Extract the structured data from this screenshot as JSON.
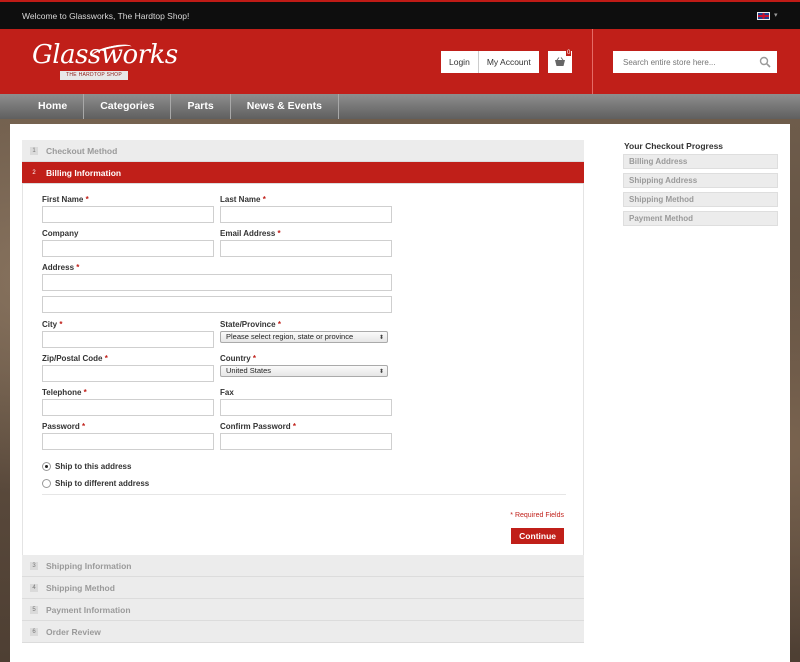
{
  "topbar": {
    "welcome": "Welcome to Glassworks, The Hardtop Shop!"
  },
  "header": {
    "logo_text": "Glassworks",
    "logo_sub": "THE HARDTOP SHOP",
    "login": "Login",
    "my_account": "My Account",
    "cart_count": "0",
    "search_placeholder": "Search entire store here..."
  },
  "nav": [
    "Home",
    "Categories",
    "Parts",
    "News & Events"
  ],
  "steps": {
    "s1": {
      "num": "1",
      "label": "Checkout Method"
    },
    "s2": {
      "num": "2",
      "label": "Billing Information"
    },
    "s3": {
      "num": "3",
      "label": "Shipping Information"
    },
    "s4": {
      "num": "4",
      "label": "Shipping Method"
    },
    "s5": {
      "num": "5",
      "label": "Payment Information"
    },
    "s6": {
      "num": "6",
      "label": "Order Review"
    }
  },
  "billing": {
    "first_name": "First Name",
    "last_name": "Last Name",
    "company": "Company",
    "email": "Email Address",
    "address": "Address",
    "city": "City",
    "state": "State/Province",
    "state_value": "Please select region, state or province",
    "zip": "Zip/Postal Code",
    "country": "Country",
    "country_value": "United States",
    "telephone": "Telephone",
    "fax": "Fax",
    "password": "Password",
    "confirm_password": "Confirm Password",
    "ship_same": "Ship to this address",
    "ship_diff": "Ship to different address",
    "required_note": "* Required Fields",
    "continue": "Continue",
    "asterisk": "*"
  },
  "progress": {
    "title": "Your Checkout Progress",
    "items": [
      "Billing Address",
      "Shipping Address",
      "Shipping Method",
      "Payment Method"
    ]
  }
}
